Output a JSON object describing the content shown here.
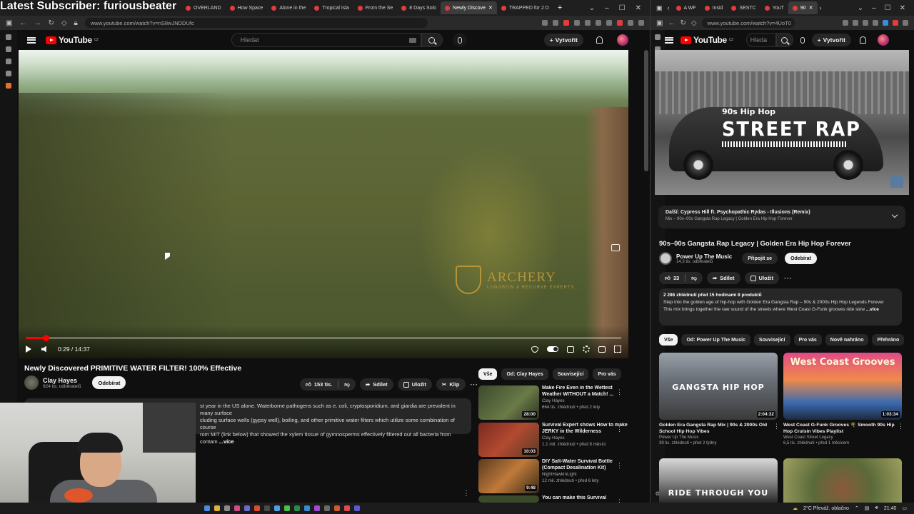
{
  "stream_overlay": {
    "text": "Latest Subscriber: furiousbeater"
  },
  "left_window": {
    "tabs": [
      {
        "label": "OVERLAND"
      },
      {
        "label": "How Space"
      },
      {
        "label": "Alone in the"
      },
      {
        "label": "Tropical Isla"
      },
      {
        "label": "From the Se"
      },
      {
        "label": "8 Days Solo"
      },
      {
        "label": "Newly Discove",
        "active": true
      },
      {
        "label": "TRAPPED for 2 D"
      }
    ],
    "url": "www.youtube.com/watch?v=nS8wJNDDUfc",
    "yt_region": "CZ",
    "brand": "YouTube",
    "search_placeholder": "Hledat",
    "create_label": "Vytvořit",
    "player": {
      "current_time": "0:29",
      "duration": "14:37",
      "time_display": "0:29 / 14:37",
      "progress_fraction": 0.033,
      "watermark_main": "ARCHERY",
      "watermark_sub": "LONGBOW & RECURVE EXPERTS"
    },
    "video": {
      "title": "Newly Discovered PRIMITIVE WATER FILTER! 100% Effective",
      "channel": "Clay Hayes",
      "subscribers": "924 tis. odběratelů",
      "subscribe_label": "Odebírat",
      "likes": "153 tis.",
      "share_label": "Sdílet",
      "save_label": "Uložit",
      "clip_label": "Klip",
      "description_head": "",
      "description_line1": "st year in the US alone. Waterborne pathogens such as e. coli, cryptosporidium, and giardia are prevalent in many surface",
      "description_line2": "cluding surface wells (gypsy well), boiling, and other primitive water filters which utilize some combination of course",
      "description_line3": "rom MIT (link below) that showed the xylem tissue of gymnosperms effectively filtered out all bacteria from contam",
      "description_more": "...více"
    },
    "chips": [
      {
        "label": "Vše",
        "selected": true
      },
      {
        "label": "Od: Clay Hayes"
      },
      {
        "label": "Související"
      },
      {
        "label": "Pro vás"
      }
    ],
    "recommendations": [
      {
        "title": "Make Fire Even in the Wettest Weather WITHOUT a Match! ...",
        "channel": "Clay Hayes",
        "meta": "664 tis. zhlédnutí • před 2 lety",
        "duration": "28:00"
      },
      {
        "title": "Survival Expert shows How to make JERKY in the Wilderness",
        "channel": "Clay Hayes",
        "meta": "1,1 mil. zhlédnutí • před 8 měsíci",
        "duration": "10:03"
      },
      {
        "title": "DIY Salt-Water Survival Bottle (Compact Desalination Kit)",
        "channel": "NightHawkInLight",
        "meta": "12 mil. zhlédnutí • před 6 lety",
        "duration": "9:48"
      },
      {
        "title": "You can make this Survival",
        "channel": "",
        "meta": "",
        "duration": ""
      }
    ]
  },
  "right_window": {
    "tabs": [
      {
        "label": "A WF"
      },
      {
        "label": "Insid"
      },
      {
        "label": "SESTC"
      },
      {
        "label": "YouT"
      },
      {
        "label": "90",
        "active": true
      }
    ],
    "url": "www.youtube.com/watch?v=4UoT0",
    "search_placeholder": "Hleda",
    "create_label": "Vytvořit",
    "thumb_small": "90s Hip Hop",
    "thumb_big": "STREET RAP",
    "next_up": "Další: Cypress Hill ft. Psychopathic Rydas - Illusions (Remix)",
    "next_sub": "Mix – 90s–00s Gangsta Rap Legacy | Golden Era Hip Hop Forever",
    "title": "90s–00s Gangsta Rap Legacy | Golden Era Hip Hop Forever",
    "channel": "Power Up The Music",
    "subscribers": "14,3 tis. odběratelů",
    "join_label": "Připojit se",
    "subscribe_label": "Odebírat",
    "likes": "33",
    "share_label": "Sdílet",
    "save_label": "Uložit",
    "desc_stats": "2 286 zhlédnutí  před 15 hodinami  8 produktů",
    "desc_line1": "Step into the golden age of hip-hop with Golden Era Gangsta Rap – 90s & 2000s Hip Hop Legends Forever",
    "desc_line2": "This mix brings together the raw sound of the streets where West Coast G-Funk grooves ride slow",
    "desc_more": "...více",
    "chips": [
      {
        "label": "Vše",
        "selected": true
      },
      {
        "label": "Od: Power Up The Music"
      },
      {
        "label": "Související"
      },
      {
        "label": "Pro vás"
      },
      {
        "label": "Nově nahráno"
      },
      {
        "label": "Přehráno"
      }
    ],
    "cards": [
      {
        "thumb_text": "GANGSTA HIP HOP",
        "title": "Golden Era Gangsta Rap Mix | 90s & 2000s Old School Hip Hop Vibes",
        "channel": "Power Up The Music",
        "meta": "39 tis. zhlédnutí • před 2 týdny",
        "duration": "2:04:32"
      },
      {
        "thumb_text": "West Coast Grooves",
        "title": "West Coast G-Funk Grooves 🌴 Smooth 90s Hip Hop Cruisin Vibes Playlist",
        "channel": "West Coast Street Legacy",
        "meta": "6,5 tis. zhlédnutí • před 1 měsícem",
        "duration": "1:03:34"
      },
      {
        "thumb_text": "RIDE THROUGH YOU",
        "title": "",
        "channel": "",
        "meta": "",
        "duration": ""
      },
      {
        "thumb_text": "",
        "title": "",
        "channel": "",
        "meta": "",
        "duration": ""
      }
    ]
  },
  "taskbar": {
    "weather": "2°C  Převáž. oblačno",
    "clock": "21:40"
  }
}
